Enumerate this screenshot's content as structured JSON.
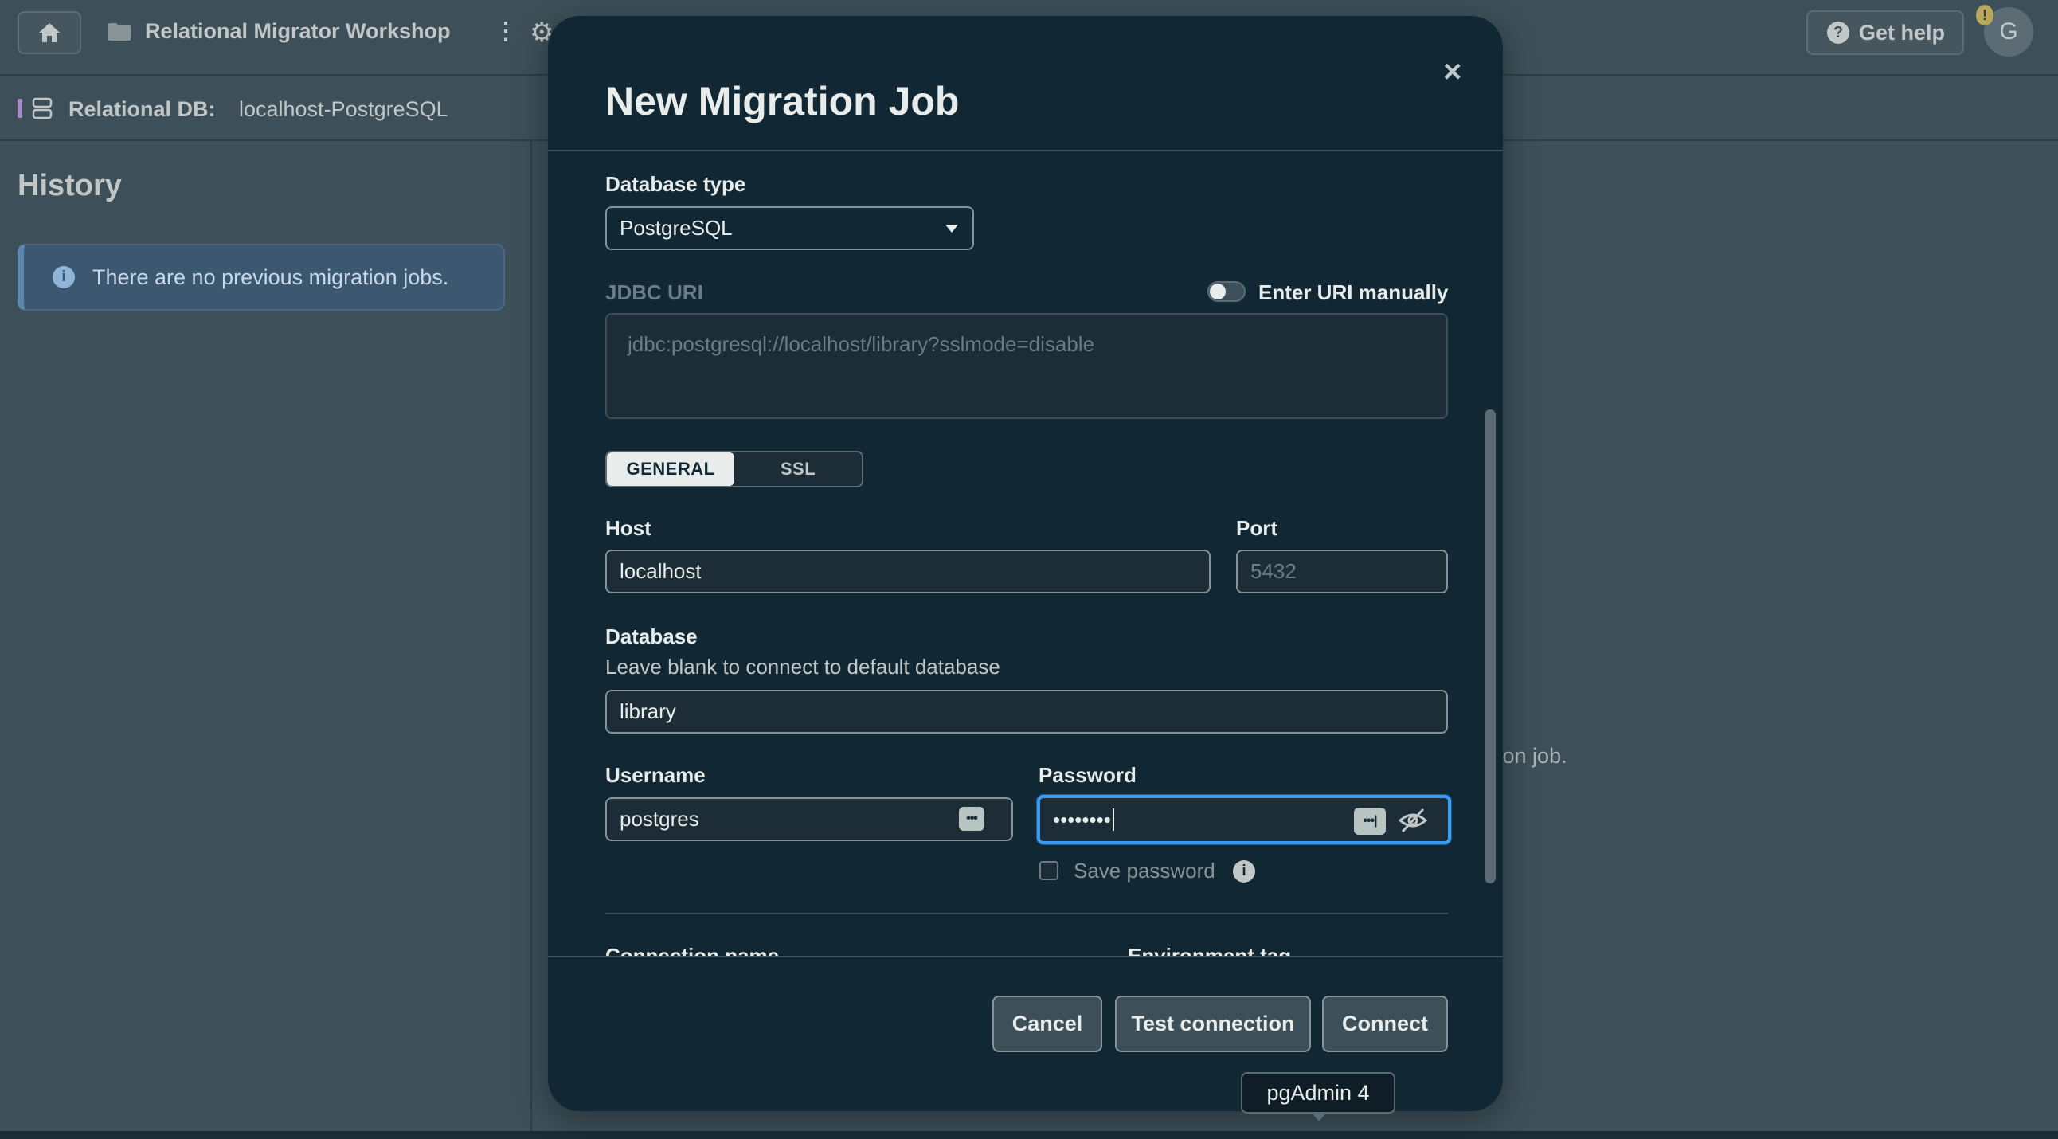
{
  "topbar": {
    "project_title": "Relational Migrator Workshop",
    "help_label": "Get help",
    "avatar_initial": "G",
    "alert_badge": "!"
  },
  "subbar": {
    "db_label": "Relational DB:",
    "db_value": "localhost-PostgreSQL"
  },
  "sidebar": {
    "title": "History",
    "info_text": "There are no previous migration jobs."
  },
  "main": {
    "partial_text": "ation job."
  },
  "modal": {
    "title": "New Migration Job",
    "close_icon": "×",
    "database_type_label": "Database type",
    "database_type_value": "PostgreSQL",
    "jdbc_uri_label": "JDBC URI",
    "enter_uri_manually_label": "Enter URI manually",
    "enter_uri_manually_on": false,
    "jdbc_uri_placeholder": "jdbc:postgresql://localhost/library?sslmode=disable",
    "tabs": [
      {
        "label": "GENERAL",
        "active": true
      },
      {
        "label": "SSL",
        "active": false
      }
    ],
    "host_label": "Host",
    "host_value": "localhost",
    "port_label": "Port",
    "port_placeholder": "5432",
    "database_label": "Database",
    "database_hint": "Leave blank to connect to default database",
    "database_value": "library",
    "username_label": "Username",
    "username_value": "postgres",
    "password_label": "Password",
    "password_value": "••••••••",
    "save_password_label": "Save password",
    "save_password_checked": false,
    "connection_name_label": "Connection name",
    "environment_tag_label": "Environment tag",
    "buttons": {
      "cancel": "Cancel",
      "test_connection": "Test connection",
      "connect": "Connect"
    }
  },
  "tooltip": {
    "text": "pgAdmin 4"
  },
  "colors": {
    "modal_bg": "#112733",
    "backdrop": "#3d4f58",
    "focus_ring": "#3d9cf0",
    "info_banner": "#3b5870"
  }
}
